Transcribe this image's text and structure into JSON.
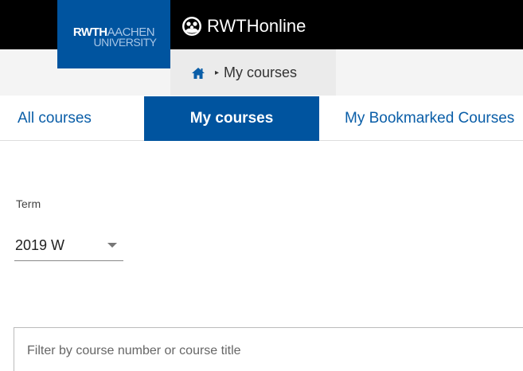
{
  "header": {
    "logo": {
      "rwth": "RWTH",
      "aachen": "AACHEN",
      "university": "UNIVERSITY"
    },
    "app_title": "RWTHonline",
    "app_icon": "globe-people-icon",
    "brand_color": "#00549f"
  },
  "breadcrumb": {
    "home_icon": "home-icon",
    "separator": "▸",
    "current": "My courses"
  },
  "tabs": [
    {
      "label": "All courses",
      "active": false
    },
    {
      "label": "My courses",
      "active": true
    },
    {
      "label": "My Bookmarked Courses",
      "active": false
    }
  ],
  "term": {
    "label": "Term",
    "value": "2019 W"
  },
  "filter": {
    "placeholder": "Filter by course number or course title"
  }
}
